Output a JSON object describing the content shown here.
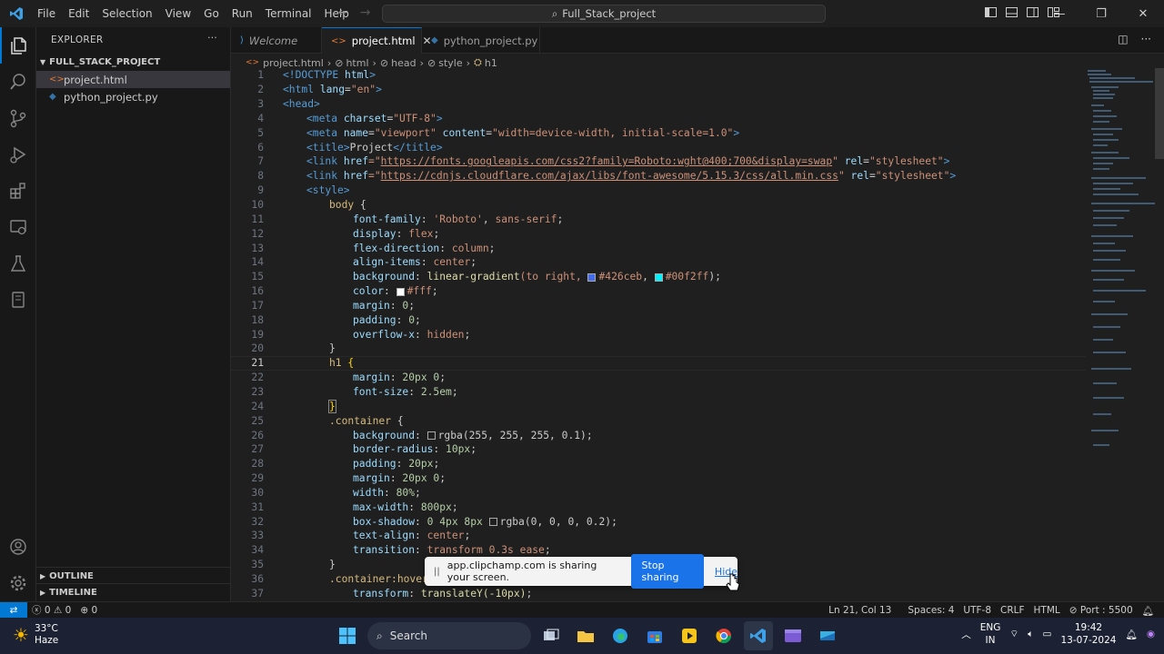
{
  "titlebar": {
    "menu": [
      "File",
      "Edit",
      "Selection",
      "View",
      "Go",
      "Run",
      "Terminal",
      "Help"
    ],
    "search": "Full_Stack_project"
  },
  "sidebar": {
    "title": "EXPLORER",
    "project": "FULL_STACK_PROJECT",
    "files": [
      "project.html",
      "python_project.py"
    ],
    "outline": "OUTLINE",
    "timeline": "TIMELINE"
  },
  "tabs": [
    "Welcome",
    "project.html",
    "python_project.py"
  ],
  "breadcrumb": [
    "project.html",
    "html",
    "head",
    "style",
    "h1"
  ],
  "code": {
    "l1": [
      "<!DOCTYPE",
      " html",
      ">"
    ],
    "l2": [
      "<html",
      " lang",
      "=",
      "\"en\"",
      ">"
    ],
    "l3": "<head>",
    "l4": [
      "<meta",
      " charset",
      "=",
      "\"UTF-8\"",
      ">"
    ],
    "l5": [
      "<meta",
      " name",
      "=",
      "\"viewport\"",
      " content",
      "=",
      "\"width=device-width, initial-scale=1.0\"",
      ">"
    ],
    "l6": [
      "<title>",
      "Project",
      "</title>"
    ],
    "l7": [
      "<link",
      " href",
      "=\"",
      "https://fonts.googleapis.com/css2?family=Roboto:wght@400;700&display=swap",
      "\"",
      " rel",
      "=",
      "\"stylesheet\"",
      ">"
    ],
    "l8": [
      "<link",
      " href",
      "=\"",
      "https://cdnjs.cloudflare.com/ajax/libs/font-awesome/5.15.3/css/all.min.css",
      "\"",
      " rel",
      "=",
      "\"stylesheet\"",
      ">"
    ],
    "l9": "<style>",
    "l10": [
      "body",
      " {"
    ],
    "l11": [
      "font-family",
      ": ",
      "'Roboto'",
      ", ",
      "sans-serif",
      ";"
    ],
    "l12": [
      "display",
      ": ",
      "flex",
      ";"
    ],
    "l13": [
      "flex-direction",
      ": ",
      "column",
      ";"
    ],
    "l14": [
      "align-items",
      ": ",
      "center",
      ";"
    ],
    "l15": [
      "background",
      ": ",
      "linear-gradient",
      "(to right, ",
      "#426ceb",
      ", ",
      "#00f2ff",
      ");"
    ],
    "l16": [
      "color",
      ": ",
      "#fff",
      ";"
    ],
    "l17": [
      "margin",
      ": ",
      "0",
      ";"
    ],
    "l18": [
      "padding",
      ": ",
      "0",
      ";"
    ],
    "l19": [
      "overflow-x",
      ": ",
      "hidden",
      ";"
    ],
    "l20": "}",
    "l21": [
      "h1",
      " {"
    ],
    "l22": [
      "margin",
      ": ",
      "20px 0",
      ";"
    ],
    "l23": [
      "font-size",
      ": ",
      "2.5em",
      ";"
    ],
    "l24": "}",
    "l25": [
      ".container",
      " {"
    ],
    "l26": [
      "background",
      ": ",
      "rgba(255, 255, 255, 0.1)",
      ";"
    ],
    "l27": [
      "border-radius",
      ": ",
      "10px",
      ";"
    ],
    "l28": [
      "padding",
      ": ",
      "20px",
      ";"
    ],
    "l29": [
      "margin",
      ": ",
      "20px 0",
      ";"
    ],
    "l30": [
      "width",
      ": ",
      "80%",
      ";"
    ],
    "l31": [
      "max-width",
      ": ",
      "800px",
      ";"
    ],
    "l32": [
      "box-shadow",
      ": ",
      "0 4px 8px ",
      "rgba(0, 0, 0, 0.2)",
      ";"
    ],
    "l33": [
      "text-align",
      ": ",
      "center",
      ";"
    ],
    "l34": [
      "transition",
      ": ",
      "transform 0.3s ease",
      ";"
    ],
    "l35": "}",
    "l36": [
      ".container:hover",
      " {"
    ],
    "l37": [
      "transform",
      ": ",
      "translateY(-10px)",
      ";"
    ]
  },
  "share_banner": {
    "text": "app.clipchamp.com is sharing your screen.",
    "stop": "Stop sharing",
    "hide": "Hide"
  },
  "statusbar": {
    "errors": "0",
    "warnings": "0",
    "ports": "0",
    "position": "Ln 21, Col 13",
    "spaces": "Spaces: 4",
    "encoding": "UTF-8",
    "eol": "CRLF",
    "language": "HTML",
    "port": "Port : 5500"
  },
  "taskbar": {
    "temp": "33°C",
    "weather": "Haze",
    "search": "Search",
    "lang1": "ENG",
    "lang2": "IN",
    "time": "19:42",
    "date": "13-07-2024"
  },
  "colors": {
    "accent": "#0078d4",
    "swatch1": "#426ceb",
    "swatch2": "#00f2ff"
  }
}
